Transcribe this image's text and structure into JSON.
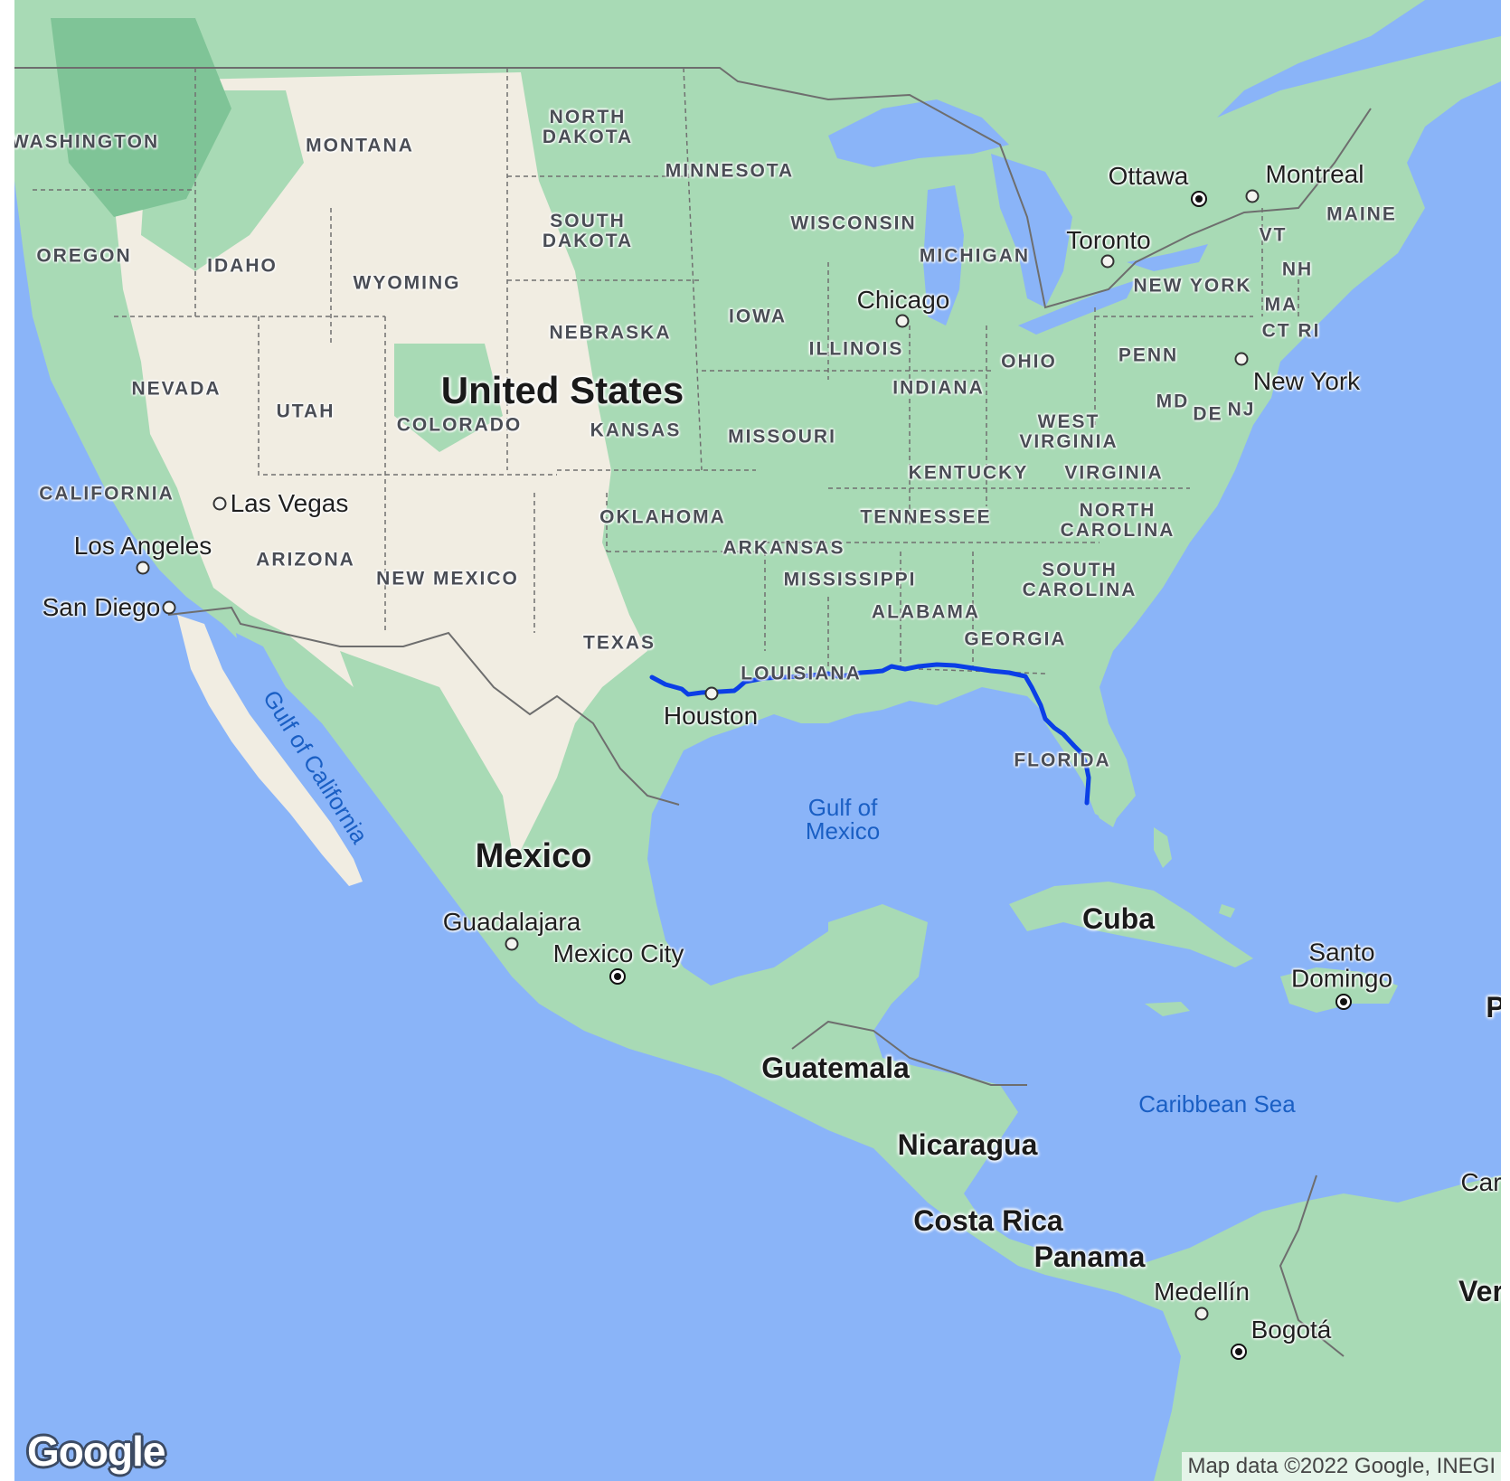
{
  "map": {
    "provider": "Google",
    "attribution": "Map data ©2022 Google, INEGI",
    "colors": {
      "water": "#8ab4f8",
      "land_green": "#a8dab5",
      "land_desert": "#f1ede2",
      "forest": "#7fc497",
      "route": "#0b3fe6",
      "border": "#6e6e6e"
    },
    "route": {
      "description": "Driving route from west of Houston along the Gulf Coast through Louisiana, Mississippi, Alabama, Florida panhandle, and down the Florida peninsula",
      "color": "#0b3fe6"
    },
    "labels": {
      "countries": [
        {
          "text": "United States"
        },
        {
          "text": "Mexico"
        },
        {
          "text": "Cuba"
        },
        {
          "text": "Guatemala"
        },
        {
          "text": "Nicaragua"
        },
        {
          "text": "Costa Rica"
        },
        {
          "text": "Panama"
        },
        {
          "text": "Ver"
        },
        {
          "text": "Car"
        },
        {
          "text": "P"
        }
      ],
      "states": [
        {
          "text": "WASHINGTON"
        },
        {
          "text": "MONTANA"
        },
        {
          "text": "NORTH DAKOTA"
        },
        {
          "text": "MINNESOTA"
        },
        {
          "text": "OREGON"
        },
        {
          "text": "IDAHO"
        },
        {
          "text": "WYOMING"
        },
        {
          "text": "SOUTH DAKOTA"
        },
        {
          "text": "WISCONSIN"
        },
        {
          "text": "MICHIGAN"
        },
        {
          "text": "NEBRASKA"
        },
        {
          "text": "IOWA"
        },
        {
          "text": "ILLINOIS"
        },
        {
          "text": "NEVADA"
        },
        {
          "text": "UTAH"
        },
        {
          "text": "COLORADO"
        },
        {
          "text": "KANSAS"
        },
        {
          "text": "MISSOURI"
        },
        {
          "text": "INDIANA"
        },
        {
          "text": "OHIO"
        },
        {
          "text": "PENN"
        },
        {
          "text": "NEW YORK"
        },
        {
          "text": "VT"
        },
        {
          "text": "NH"
        },
        {
          "text": "MA"
        },
        {
          "text": "CT RI"
        },
        {
          "text": "MAINE"
        },
        {
          "text": "MD"
        },
        {
          "text": "DE"
        },
        {
          "text": "NJ"
        },
        {
          "text": "WEST VIRGINIA"
        },
        {
          "text": "KENTUCKY"
        },
        {
          "text": "VIRGINIA"
        },
        {
          "text": "CALIFORNIA"
        },
        {
          "text": "ARIZONA"
        },
        {
          "text": "NEW MEXICO"
        },
        {
          "text": "OKLAHOMA"
        },
        {
          "text": "TENNESSEE"
        },
        {
          "text": "NORTH CAROLINA"
        },
        {
          "text": "ARKANSAS"
        },
        {
          "text": "MISSISSIPPI"
        },
        {
          "text": "SOUTH CAROLINA"
        },
        {
          "text": "ALABAMA"
        },
        {
          "text": "GEORGIA"
        },
        {
          "text": "TEXAS"
        },
        {
          "text": "LOUISIANA"
        },
        {
          "text": "FLORIDA"
        }
      ],
      "cities": [
        {
          "text": "Ottawa",
          "capital": true
        },
        {
          "text": "Montreal",
          "capital": false
        },
        {
          "text": "Toronto",
          "capital": false
        },
        {
          "text": "Chicago",
          "capital": false
        },
        {
          "text": "New York",
          "capital": false
        },
        {
          "text": "Las Vegas",
          "capital": false
        },
        {
          "text": "Los Angeles",
          "capital": false
        },
        {
          "text": "San Diego",
          "capital": false
        },
        {
          "text": "Houston",
          "capital": false
        },
        {
          "text": "Guadalajara",
          "capital": false
        },
        {
          "text": "Mexico City",
          "capital": true
        },
        {
          "text": "Santo Domingo",
          "capital": true
        },
        {
          "text": "Medellín",
          "capital": false
        },
        {
          "text": "Bogotá",
          "capital": true
        }
      ],
      "water": [
        {
          "text": "Gulf of Mexico"
        },
        {
          "text": "Gulf of California"
        },
        {
          "text": "Caribbean Sea"
        }
      ]
    }
  }
}
